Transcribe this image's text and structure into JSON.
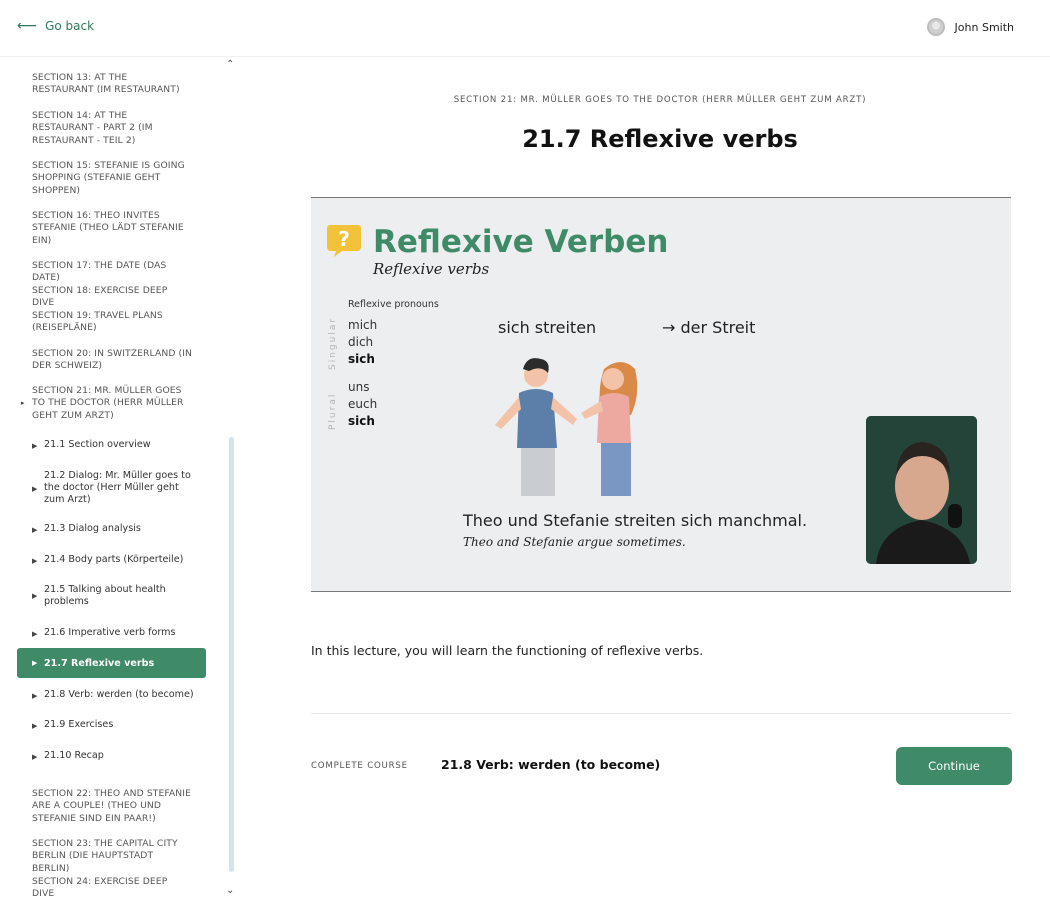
{
  "header": {
    "back_label": "Go back",
    "user_name": "John Smith"
  },
  "sidebar": {
    "sections_before": [
      {
        "label": "SECTION 13: AT THE RESTAURANT (IM RESTAURANT)"
      },
      {
        "label": "SECTION 14: AT THE RESTAURANT - PART 2 (IM RESTAURANT - TEIL 2)"
      },
      {
        "label": "SECTION 15: STEFANIE IS GOING SHOPPING (STEFANIE GEHT SHOPPEN)"
      },
      {
        "label": "SECTION 16: THEO INVITES STEFANIE (THEO LÄDT STEFANIE EIN)"
      },
      {
        "label": "SECTION 17: THE DATE (DAS DATE)"
      },
      {
        "label": "SECTION 18: EXERCISE DEEP DIVE"
      },
      {
        "label": "SECTION 19: TRAVEL PLANS (REISEPLÄNE)"
      },
      {
        "label": "SECTION 20: IN SWITZERLAND (IN DER SCHWEIZ)"
      }
    ],
    "current_section": "SECTION 21: MR. MÜLLER GOES TO THE DOCTOR (HERR MÜLLER GEHT ZUM ARZT)",
    "lectures": [
      {
        "label": "21.1 Section overview"
      },
      {
        "label": "21.2 Dialog: Mr. Müller goes to the doctor (Herr Müller geht zum Arzt)"
      },
      {
        "label": "21.3 Dialog analysis"
      },
      {
        "label": "21.4 Body parts (Körperteile)"
      },
      {
        "label": "21.5 Talking about health problems"
      },
      {
        "label": "21.6 Imperative verb forms"
      },
      {
        "label": "21.7 Reflexive verbs"
      },
      {
        "label": "21.8 Verb: werden (to become)"
      },
      {
        "label": "21.9 Exercises"
      },
      {
        "label": "21.10 Recap"
      }
    ],
    "sections_after": [
      {
        "label": "SECTION 22: THEO AND STEFANIE ARE A COUPLE! (THEO UND STEFANIE SIND EIN PAAR!)"
      },
      {
        "label": "SECTION 23: THE CAPITAL CITY BERLIN (DIE HAUPTSTADT BERLIN)"
      },
      {
        "label": "SECTION 24: EXERCISE DEEP DIVE"
      }
    ]
  },
  "main": {
    "section_title": "SECTION 21: MR. MÜLLER GOES TO THE DOCTOR (HERR MÜLLER GEHT ZUM ARZT)",
    "lecture_title": "21.7 Reflexive verbs",
    "video": {
      "heading": "Reflexive Verben",
      "subheading": "Reflexive verbs",
      "pronouns_label": "Reflexive pronouns",
      "singular_label": "Singular",
      "plural_label": "Plural",
      "singular": [
        "mich",
        "dich",
        "sich"
      ],
      "plural": [
        "uns",
        "euch",
        "sich"
      ],
      "verb": "sich streiten",
      "noun": "→ der Streit",
      "sentence": "Theo und Stefanie streiten sich manchmal.",
      "sentence_en": "Theo and Stefanie argue sometimes.",
      "accent_color": "#3f8a67"
    },
    "description": "In this lecture, you will learn the functioning of reflexive verbs.",
    "footer": {
      "complete_label": "COMPLETE COURSE",
      "next_lecture": "21.8 Verb: werden (to become)",
      "continue_label": "Continue"
    }
  }
}
